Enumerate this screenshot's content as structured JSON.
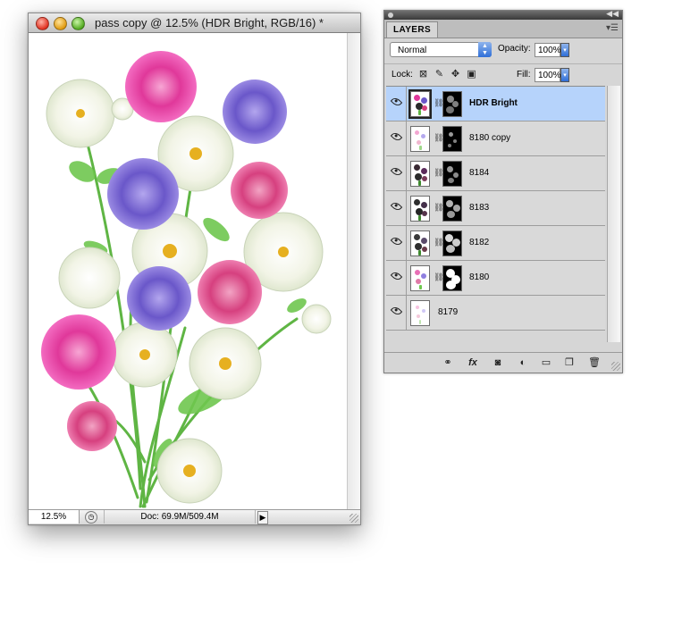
{
  "document": {
    "title": "pass copy @ 12.5% (HDR Bright, RGB/16) *",
    "zoom": "12.5%",
    "doc_info": "Doc: 69.9M/509.4M"
  },
  "layers_panel": {
    "tab_label": "LAYERS",
    "blend_mode": "Normal",
    "opacity_label": "Opacity:",
    "opacity_value": "100%",
    "lock_label": "Lock:",
    "fill_label": "Fill:",
    "fill_value": "100%",
    "layers": [
      {
        "name": "HDR Bright",
        "selected": true,
        "has_mask": true
      },
      {
        "name": "8180 copy",
        "selected": false,
        "has_mask": true
      },
      {
        "name": "8184",
        "selected": false,
        "has_mask": true
      },
      {
        "name": "8183",
        "selected": false,
        "has_mask": true
      },
      {
        "name": "8182",
        "selected": false,
        "has_mask": true
      },
      {
        "name": "8180",
        "selected": false,
        "has_mask": true
      },
      {
        "name": "8179",
        "selected": false,
        "has_mask": false
      }
    ]
  },
  "colors": {
    "selection": "#b6d3fb",
    "magenta_flower": "#e0389a",
    "pink_flower": "#d6407f",
    "violet_flower": "#6a57c9",
    "white_flower": "#f4f5ea",
    "stem": "#5fb544",
    "flower_center": "#e6b020"
  }
}
